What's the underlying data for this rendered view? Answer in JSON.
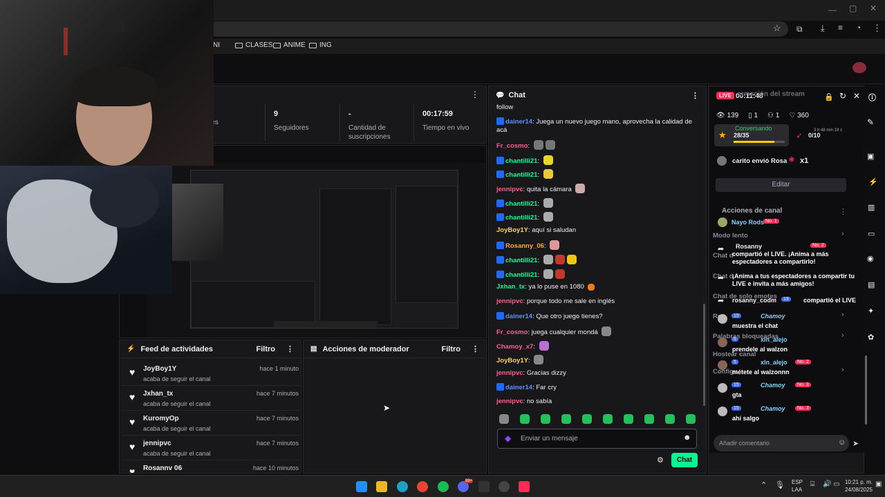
{
  "bookmarks": [
    "NI",
    "CLASES",
    "ANIME",
    "ING"
  ],
  "stats": [
    {
      "value": "",
      "label": "ectadores"
    },
    {
      "value": "9",
      "label": "Seguidores"
    },
    {
      "value": "-",
      "label": "Cantidad de suscripciones"
    },
    {
      "value": "00:17:59",
      "label": "Tiempo en vivo"
    }
  ],
  "feed": {
    "title": "Feed de actividades",
    "filter": "Filtro",
    "items": [
      {
        "name": "JoyBoy1Y",
        "desc": "acaba de seguir el canal",
        "time": "hace 1 minuto"
      },
      {
        "name": "Jxhan_tx",
        "desc": "acaba de seguir el canal",
        "time": "hace 7 minutos"
      },
      {
        "name": "KuromyOp",
        "desc": "acaba de seguir el canal",
        "time": "hace 7 minutos"
      },
      {
        "name": "jennipvc",
        "desc": "acaba de seguir el canal",
        "time": "hace 7 minutos"
      },
      {
        "name": "Rosannv 06",
        "desc": "",
        "time": "hace 10 minutos"
      }
    ]
  },
  "mod": {
    "title": "Acciones de moderador",
    "filter": "Filtro"
  },
  "chat": {
    "title": "Chat",
    "placeholder": "Enviar un mensaje",
    "send": "Chat",
    "messages": [
      {
        "user": "",
        "text": "follow",
        "color": "#efeff1"
      },
      {
        "user": "dainer14",
        "text": "Juega un nuevo juego mano, aprovecha la calidad de acá",
        "color": "#5c8eff"
      },
      {
        "user": "Fr_cosmo",
        "text": "",
        "color": "#ff5f8f"
      },
      {
        "user": "chantilli21",
        "text": "",
        "color": "#00ff99"
      },
      {
        "user": "chantilli21",
        "text": "",
        "color": "#00ff99"
      },
      {
        "user": "jennipvc",
        "text": "quita la cámara",
        "color": "#ff5f8f"
      },
      {
        "user": "chantilli21",
        "text": "",
        "color": "#00ff99"
      },
      {
        "user": "chantilli21",
        "text": "",
        "color": "#00ff99"
      },
      {
        "user": "JoyBoy1Y",
        "text": "aquí si saludan",
        "color": "#ffd54a"
      },
      {
        "user": "Rosanny_06",
        "text": "",
        "color": "#ffa53a"
      },
      {
        "user": "chantilli21",
        "text": "",
        "color": "#00ff99"
      },
      {
        "user": "chantilli21",
        "text": "",
        "color": "#00ff99"
      },
      {
        "user": "Jxhan_tx",
        "text": "ya lo puse en 1080",
        "color": "#00ff99"
      },
      {
        "user": "jennipvc",
        "text": "porque todo me sale en inglés",
        "color": "#ff5f8f"
      },
      {
        "user": "dainer14",
        "text": "Que otro juego tienes?",
        "color": "#5c8eff"
      },
      {
        "user": "Fr_cosmo",
        "text": "juega cualquier mondá",
        "color": "#ff5f8f"
      },
      {
        "user": "Chamoy_x7",
        "text": "",
        "color": "#ff5f8f"
      },
      {
        "user": "JoyBoy1Y",
        "text": "",
        "color": "#ffd54a"
      },
      {
        "user": "jennipvc",
        "text": "Gracias dizzy",
        "color": "#ff5f8f"
      },
      {
        "user": "dainer14",
        "text": "Far cry",
        "color": "#5c8eff"
      },
      {
        "user": "jennipvc",
        "text": "no sabía",
        "color": "#ff5f8f"
      }
    ]
  },
  "tiktok": {
    "live_badge": "LIVE",
    "timer": "00:11:48",
    "info_title": "ormación del stream",
    "viewers": "139",
    "gifts": "1",
    "users": "1",
    "likes": "360",
    "conversando": "Conversando",
    "progress": "28/35",
    "progress2": "0/10",
    "time_left": "3 h 48 min 19 s",
    "gift_line": "carito envió Rosa",
    "gift_count": "x1",
    "edit": "Editar",
    "channel_actions": "Acciones de canal",
    "comment_placeholder": "Añadir comentario",
    "bg_labels": [
      "Modo lento",
      "Chat d",
      "Chat d",
      "Chat de solo emotes",
      "Re",
      "Palabras bloqueadas",
      "Hostear canal",
      "Configu"
    ],
    "comments": [
      {
        "user": "Nayo Rods",
        "badge": "No. 1",
        "text": ""
      },
      {
        "user": "Rosanny",
        "badge": "No. 2",
        "text": "compartió el LIVE. ¡Anima a más espectadores a compartirlo!"
      },
      {
        "user": "",
        "badge": "",
        "text": "¡Anima a tus espectadores a compartir tu LIVE e invita a más amigos!"
      },
      {
        "user": "rosanny_codm",
        "badge": "19",
        "text": "compartió el LIVE"
      },
      {
        "user": "Chamoy",
        "badge": "15",
        "text": "muestra el chat"
      },
      {
        "user": "xln_alejo",
        "badge": "5",
        "text": "prendele al walzon"
      },
      {
        "user": "xln_alejo",
        "badge": "No. 2",
        "text": "métete al walzonnn"
      },
      {
        "user": "Chamoy",
        "badge": "No. 3",
        "text": "gta"
      },
      {
        "user": "Chamoy",
        "badge": "No. 3",
        "text": "ahí salgo"
      }
    ]
  },
  "taskbar": {
    "lang": "ESP",
    "lang2": "LAA",
    "time": "10:21 p. m.",
    "date": "24/08/2025",
    "badge": "99+"
  },
  "colors": {
    "accent": "#00f593",
    "twitch_blue": "#1f69ff",
    "live": "#fe2c55"
  }
}
